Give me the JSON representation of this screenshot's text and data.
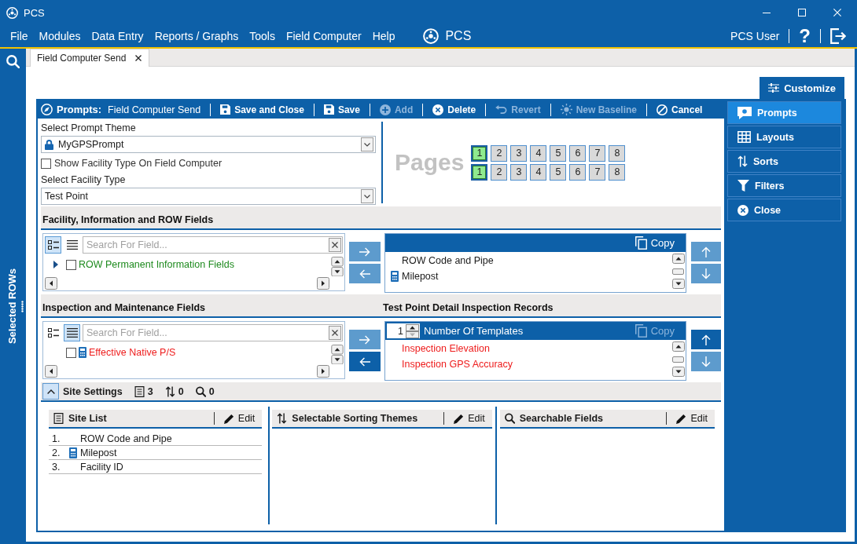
{
  "window": {
    "title": "PCS"
  },
  "menu": {
    "items": [
      "File",
      "Modules",
      "Data Entry",
      "Reports / Graphs",
      "Tools",
      "Field Computer",
      "Help"
    ],
    "brand": "PCS",
    "user": "PCS User",
    "help": "?"
  },
  "sidebar": {
    "label": "Selected ROWs"
  },
  "tabs": [
    {
      "label": "Field Computer Send",
      "selected": true
    }
  ],
  "customize": {
    "label": "Customize"
  },
  "toolbar": {
    "title": "Prompts:",
    "subtitle": "Field Computer Send",
    "actions": [
      {
        "kind": "save_close",
        "label": "Save and Close",
        "disabled": false
      },
      {
        "kind": "save",
        "label": "Save",
        "disabled": false
      },
      {
        "kind": "add",
        "label": "Add",
        "disabled": true
      },
      {
        "kind": "delete",
        "label": "Delete",
        "disabled": false
      },
      {
        "kind": "revert",
        "label": "Revert",
        "disabled": true
      },
      {
        "kind": "baseline",
        "label": "New Baseline",
        "disabled": true
      },
      {
        "kind": "cancel",
        "label": "Cancel",
        "disabled": false
      }
    ]
  },
  "side_menu": [
    {
      "kind": "prompts",
      "label": "Prompts",
      "selected": true
    },
    {
      "kind": "layouts",
      "label": "Layouts",
      "selected": false
    },
    {
      "kind": "sorts",
      "label": "Sorts",
      "selected": false
    },
    {
      "kind": "filters",
      "label": "Filters",
      "selected": false
    },
    {
      "kind": "close",
      "label": "Close",
      "selected": false
    }
  ],
  "settings": {
    "theme_label": "Select Prompt Theme",
    "theme": "MyGPSPrompt",
    "theme_locked": true,
    "show_facility": {
      "label": "Show Facility Type On Field Computer",
      "checked": false
    },
    "facility_label": "Select Facility Type",
    "facility": "Test Point"
  },
  "pages": {
    "label": "Pages",
    "rows": [
      [
        {
          "label": "1",
          "selected": true
        },
        {
          "label": "2",
          "selected": false
        },
        {
          "label": "3",
          "selected": false
        },
        {
          "label": "4",
          "selected": false
        },
        {
          "label": "5",
          "selected": false
        },
        {
          "label": "6",
          "selected": false
        },
        {
          "label": "7",
          "selected": false
        },
        {
          "label": "8",
          "selected": false
        }
      ],
      [
        {
          "label": "1",
          "selected": true
        },
        {
          "label": "2",
          "selected": false
        },
        {
          "label": "3",
          "selected": false
        },
        {
          "label": "4",
          "selected": false
        },
        {
          "label": "5",
          "selected": false
        },
        {
          "label": "6",
          "selected": false
        },
        {
          "label": "7",
          "selected": false
        },
        {
          "label": "8",
          "selected": false
        }
      ]
    ]
  },
  "field_sections": [
    {
      "title": "Facility, Information and ROW Fields",
      "views": [
        {
          "kind": "tree",
          "selected": true
        },
        {
          "kind": "list",
          "selected": false
        }
      ],
      "search_placeholder": "Search For Field...",
      "available": [
        {
          "kind": "group",
          "label": "ROW Permanent Information Fields",
          "expanded": false,
          "checked": false,
          "calculated": false,
          "color": "#1e8a1e"
        }
      ],
      "move_buttons": [
        {
          "kind": "right",
          "disabled": true
        },
        {
          "kind": "left",
          "disabled": true
        }
      ],
      "target": {
        "copy": "Copy",
        "copy_disabled": false,
        "items": [
          {
            "label": "ROW Code and Pipe",
            "calculated": false,
            "color": "#1a1a1a"
          },
          {
            "label": "Milepost",
            "calculated": true,
            "color": "#1a1a1a"
          }
        ]
      },
      "order_buttons": [
        {
          "kind": "up",
          "disabled": true
        },
        {
          "kind": "down",
          "disabled": true
        }
      ]
    },
    {
      "title": "Inspection and Maintenance Fields",
      "views": [
        {
          "kind": "tree",
          "selected": false
        },
        {
          "kind": "list",
          "selected": true
        }
      ],
      "search_placeholder": "Search For Field...",
      "available": [
        {
          "kind": "field",
          "label": "Effective Native P/S",
          "checked": false,
          "calculated": true,
          "color": "#ee1c1c"
        }
      ],
      "move_buttons": [
        {
          "kind": "right",
          "disabled": true
        },
        {
          "kind": "left",
          "disabled": false
        }
      ],
      "target": {
        "title": "Test Point Detail Inspection Records",
        "template_count": "1",
        "template_label": "Number Of Templates",
        "copy": "Copy",
        "copy_disabled": true,
        "items": [
          {
            "label": "Inspection Elevation",
            "calculated": false,
            "color": "#ee1c1c"
          },
          {
            "label": "Inspection GPS Accuracy",
            "calculated": false,
            "color": "#ee1c1c"
          }
        ]
      },
      "order_buttons": [
        {
          "kind": "up",
          "disabled": false
        },
        {
          "kind": "down",
          "disabled": true
        }
      ]
    }
  ],
  "site_settings": {
    "title": "Site Settings",
    "expanded": true,
    "counts": [
      {
        "kind": "list",
        "value": "3"
      },
      {
        "kind": "sort",
        "value": "0"
      },
      {
        "kind": "search",
        "value": "0"
      }
    ],
    "panels": [
      {
        "kind": "list",
        "title": "Site List",
        "edit": "Edit",
        "items": [
          {
            "number": "1.",
            "label": "ROW Code and Pipe",
            "calculated": false
          },
          {
            "number": "2.",
            "label": "Milepost",
            "calculated": true
          },
          {
            "number": "3.",
            "label": "Facility ID",
            "calculated": false
          }
        ]
      },
      {
        "kind": "sort",
        "title": "Selectable Sorting Themes",
        "edit": "Edit"
      },
      {
        "kind": "search",
        "title": "Searchable Fields",
        "edit": "Edit"
      }
    ]
  }
}
